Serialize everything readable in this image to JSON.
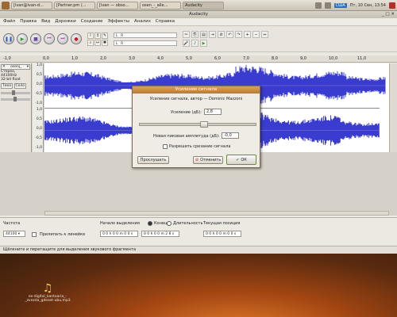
{
  "panel": {
    "tasks": [
      "[ivan@ivan-d...",
      "[Partner.pm (...",
      "[ivan — obso...",
      "osen_-_alle...",
      "Audacity"
    ],
    "lang": "США",
    "clock": "Пт, 10 Сен, 13:54"
  },
  "window": {
    "title": "Audacity"
  },
  "menu": [
    "Файл",
    "Правка",
    "Вид",
    "Дорожки",
    "Создание",
    "Эффекты",
    "Анализ",
    "Справка"
  ],
  "ruler": [
    "-1,0",
    "0,0",
    "1,0",
    "2,0",
    "3,0",
    "4,0",
    "5,0",
    "6,0",
    "7,0",
    "8,0",
    "9,0",
    "10,0",
    "11,0"
  ],
  "track": {
    "name": "osenj_",
    "format1": "Стерео, 44100Hz",
    "format2": "32-bit float",
    "mute": "Тихо",
    "solo": "Соло",
    "scale": [
      "1,0",
      "0,5",
      "0,0",
      "-0,5",
      "-1,0",
      "1,0",
      "0,5",
      "0,0",
      "-0,5",
      "-1,0"
    ]
  },
  "selection": {
    "rate_label": "Частота",
    "rate_value": "44100",
    "snap_label": "Прилипать к линейке",
    "start_label": "Начало выделения",
    "end_radio": "Конец",
    "length_radio": "Длительность",
    "pos_label": "Текущая позиция",
    "start_value": "0 0 h 0 0 m 0 0 s",
    "end_value": "0 0 h 0 0 m 2 8 s",
    "pos_value": "0 0 h 0 0 m 0 0 s"
  },
  "status": "Щёлкните и перетащите для выделения звукового фрагмента",
  "dialog": {
    "title": "Усиление сигнала",
    "subtitle": "Усиление сигнала, автор — Dominic Mazzoni",
    "gain_label": "Усиление (дБ):",
    "gain_value": "2,8",
    "peak_label": "Новая пиковая амплитуда (дБ):",
    "peak_value": "-0,0",
    "clip_label": "Разрешить срезание сигнала",
    "preview": "Прослушать",
    "cancel": "Отменить",
    "ok": "ОК",
    "slider_level": 0.55
  },
  "desktop": {
    "icon_label": "ex-digital_kantoaria_-_zvezda_gdeset-ubu.mp3"
  },
  "colors": {
    "wave": "#3a3ccf",
    "accent": "#d07a2a"
  }
}
